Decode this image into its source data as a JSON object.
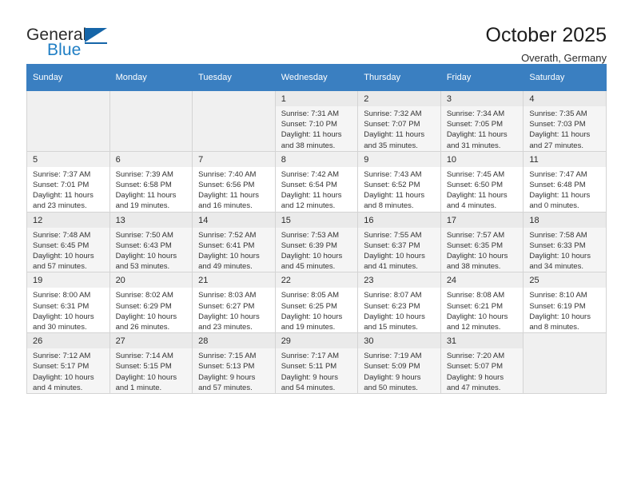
{
  "brand": {
    "name_top": "General",
    "name_bottom": "Blue",
    "accent_color": "#1f7ec4",
    "triangle_color": "#1565a8"
  },
  "header": {
    "title": "October 2025",
    "subtitle": "Overath, Germany"
  },
  "calendar": {
    "header_bg": "#3a7fc1",
    "weekdays": [
      "Sunday",
      "Monday",
      "Tuesday",
      "Wednesday",
      "Thursday",
      "Friday",
      "Saturday"
    ],
    "leading_blanks": 3,
    "labels": {
      "sunrise": "Sunrise:",
      "sunset": "Sunset:",
      "daylight": "Daylight:"
    },
    "days": [
      {
        "n": "1",
        "sunrise": "Sunrise: 7:31 AM",
        "sunset": "Sunset: 7:10 PM",
        "day1": "Daylight: 11 hours",
        "day2": "and 38 minutes."
      },
      {
        "n": "2",
        "sunrise": "Sunrise: 7:32 AM",
        "sunset": "Sunset: 7:07 PM",
        "day1": "Daylight: 11 hours",
        "day2": "and 35 minutes."
      },
      {
        "n": "3",
        "sunrise": "Sunrise: 7:34 AM",
        "sunset": "Sunset: 7:05 PM",
        "day1": "Daylight: 11 hours",
        "day2": "and 31 minutes."
      },
      {
        "n": "4",
        "sunrise": "Sunrise: 7:35 AM",
        "sunset": "Sunset: 7:03 PM",
        "day1": "Daylight: 11 hours",
        "day2": "and 27 minutes."
      },
      {
        "n": "5",
        "sunrise": "Sunrise: 7:37 AM",
        "sunset": "Sunset: 7:01 PM",
        "day1": "Daylight: 11 hours",
        "day2": "and 23 minutes."
      },
      {
        "n": "6",
        "sunrise": "Sunrise: 7:39 AM",
        "sunset": "Sunset: 6:58 PM",
        "day1": "Daylight: 11 hours",
        "day2": "and 19 minutes."
      },
      {
        "n": "7",
        "sunrise": "Sunrise: 7:40 AM",
        "sunset": "Sunset: 6:56 PM",
        "day1": "Daylight: 11 hours",
        "day2": "and 16 minutes."
      },
      {
        "n": "8",
        "sunrise": "Sunrise: 7:42 AM",
        "sunset": "Sunset: 6:54 PM",
        "day1": "Daylight: 11 hours",
        "day2": "and 12 minutes."
      },
      {
        "n": "9",
        "sunrise": "Sunrise: 7:43 AM",
        "sunset": "Sunset: 6:52 PM",
        "day1": "Daylight: 11 hours",
        "day2": "and 8 minutes."
      },
      {
        "n": "10",
        "sunrise": "Sunrise: 7:45 AM",
        "sunset": "Sunset: 6:50 PM",
        "day1": "Daylight: 11 hours",
        "day2": "and 4 minutes."
      },
      {
        "n": "11",
        "sunrise": "Sunrise: 7:47 AM",
        "sunset": "Sunset: 6:48 PM",
        "day1": "Daylight: 11 hours",
        "day2": "and 0 minutes."
      },
      {
        "n": "12",
        "sunrise": "Sunrise: 7:48 AM",
        "sunset": "Sunset: 6:45 PM",
        "day1": "Daylight: 10 hours",
        "day2": "and 57 minutes."
      },
      {
        "n": "13",
        "sunrise": "Sunrise: 7:50 AM",
        "sunset": "Sunset: 6:43 PM",
        "day1": "Daylight: 10 hours",
        "day2": "and 53 minutes."
      },
      {
        "n": "14",
        "sunrise": "Sunrise: 7:52 AM",
        "sunset": "Sunset: 6:41 PM",
        "day1": "Daylight: 10 hours",
        "day2": "and 49 minutes."
      },
      {
        "n": "15",
        "sunrise": "Sunrise: 7:53 AM",
        "sunset": "Sunset: 6:39 PM",
        "day1": "Daylight: 10 hours",
        "day2": "and 45 minutes."
      },
      {
        "n": "16",
        "sunrise": "Sunrise: 7:55 AM",
        "sunset": "Sunset: 6:37 PM",
        "day1": "Daylight: 10 hours",
        "day2": "and 41 minutes."
      },
      {
        "n": "17",
        "sunrise": "Sunrise: 7:57 AM",
        "sunset": "Sunset: 6:35 PM",
        "day1": "Daylight: 10 hours",
        "day2": "and 38 minutes."
      },
      {
        "n": "18",
        "sunrise": "Sunrise: 7:58 AM",
        "sunset": "Sunset: 6:33 PM",
        "day1": "Daylight: 10 hours",
        "day2": "and 34 minutes."
      },
      {
        "n": "19",
        "sunrise": "Sunrise: 8:00 AM",
        "sunset": "Sunset: 6:31 PM",
        "day1": "Daylight: 10 hours",
        "day2": "and 30 minutes."
      },
      {
        "n": "20",
        "sunrise": "Sunrise: 8:02 AM",
        "sunset": "Sunset: 6:29 PM",
        "day1": "Daylight: 10 hours",
        "day2": "and 26 minutes."
      },
      {
        "n": "21",
        "sunrise": "Sunrise: 8:03 AM",
        "sunset": "Sunset: 6:27 PM",
        "day1": "Daylight: 10 hours",
        "day2": "and 23 minutes."
      },
      {
        "n": "22",
        "sunrise": "Sunrise: 8:05 AM",
        "sunset": "Sunset: 6:25 PM",
        "day1": "Daylight: 10 hours",
        "day2": "and 19 minutes."
      },
      {
        "n": "23",
        "sunrise": "Sunrise: 8:07 AM",
        "sunset": "Sunset: 6:23 PM",
        "day1": "Daylight: 10 hours",
        "day2": "and 15 minutes."
      },
      {
        "n": "24",
        "sunrise": "Sunrise: 8:08 AM",
        "sunset": "Sunset: 6:21 PM",
        "day1": "Daylight: 10 hours",
        "day2": "and 12 minutes."
      },
      {
        "n": "25",
        "sunrise": "Sunrise: 8:10 AM",
        "sunset": "Sunset: 6:19 PM",
        "day1": "Daylight: 10 hours",
        "day2": "and 8 minutes."
      },
      {
        "n": "26",
        "sunrise": "Sunrise: 7:12 AM",
        "sunset": "Sunset: 5:17 PM",
        "day1": "Daylight: 10 hours",
        "day2": "and 4 minutes."
      },
      {
        "n": "27",
        "sunrise": "Sunrise: 7:14 AM",
        "sunset": "Sunset: 5:15 PM",
        "day1": "Daylight: 10 hours",
        "day2": "and 1 minute."
      },
      {
        "n": "28",
        "sunrise": "Sunrise: 7:15 AM",
        "sunset": "Sunset: 5:13 PM",
        "day1": "Daylight: 9 hours",
        "day2": "and 57 minutes."
      },
      {
        "n": "29",
        "sunrise": "Sunrise: 7:17 AM",
        "sunset": "Sunset: 5:11 PM",
        "day1": "Daylight: 9 hours",
        "day2": "and 54 minutes."
      },
      {
        "n": "30",
        "sunrise": "Sunrise: 7:19 AM",
        "sunset": "Sunset: 5:09 PM",
        "day1": "Daylight: 9 hours",
        "day2": "and 50 minutes."
      },
      {
        "n": "31",
        "sunrise": "Sunrise: 7:20 AM",
        "sunset": "Sunset: 5:07 PM",
        "day1": "Daylight: 9 hours",
        "day2": "and 47 minutes."
      }
    ]
  }
}
